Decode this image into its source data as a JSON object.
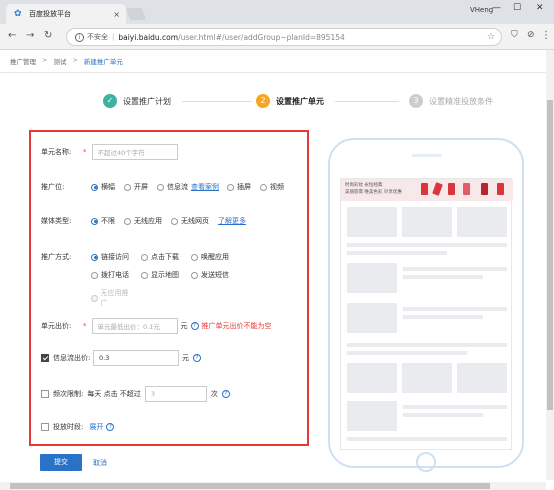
{
  "browser": {
    "tab_title": "百度投放平台",
    "tab_close": "×",
    "user_name": "VHeng",
    "win_minimize": "—",
    "win_maximize": "☐",
    "win_close": "✕",
    "security_label": "不安全",
    "url_host": "baiyi.baidu.com",
    "url_path": "/user.html#/user/addGroup~planId=895154"
  },
  "breadcrumb": {
    "items": [
      "推广管理",
      "测试",
      "新建推广单元"
    ],
    "separator": ">"
  },
  "steps": [
    {
      "num": "✓",
      "label": "设置推广计划",
      "state": "done"
    },
    {
      "num": "2",
      "label": "设置推广单元",
      "state": "active"
    },
    {
      "num": "3",
      "label": "设置精准投放条件",
      "state": "pending"
    }
  ],
  "form": {
    "unit_name": {
      "label": "单元名称:",
      "required": "*",
      "placeholder": "不超过40个字符"
    },
    "position": {
      "label": "推广位:",
      "options": [
        "横幅",
        "开屏",
        "信息流",
        "插屏",
        "视频"
      ],
      "selected": "横幅",
      "example_link": "查看案例"
    },
    "media_type": {
      "label": "媒体类型:",
      "options": [
        "不限",
        "无线应用",
        "无线网页"
      ],
      "selected": "不限",
      "more_link": "了解更多"
    },
    "promo_method": {
      "label": "推广方式:",
      "options": [
        "链接访问",
        "点击下载",
        "唤醒应用",
        "拨打电话",
        "显示地图",
        "发送短信",
        "无应用推广"
      ],
      "selected": "链接访问",
      "disabled": "无应用推广"
    },
    "unit_bid": {
      "label": "单元出价:",
      "required": "*",
      "placeholder": "单元最低出价：0.1元",
      "unit": "元",
      "help": "?",
      "error": "推广单元出价不能为空"
    },
    "feed_bid": {
      "label": "信息流出价:",
      "checked": true,
      "value": "0.3",
      "unit": "元",
      "help": "?"
    },
    "frequency": {
      "label": "频次限制:",
      "checked": false,
      "prefix": "每天 点击 不超过",
      "value": "3",
      "unit": "次",
      "help": "?"
    },
    "schedule": {
      "label": "投放时段:",
      "checked": false,
      "expand": "展开",
      "help": "?"
    }
  },
  "actions": {
    "submit": "提交",
    "cancel": "取消"
  },
  "preview": {
    "banner_text_1": "时尚彩妆 永恒经典",
    "banner_text_2": "美丽唇膏 唯美色彩 尽享优惠"
  },
  "colors": {
    "accent": "#2a72c8",
    "done": "#3bb3a0",
    "active": "#f5a623",
    "pending": "#cccccc",
    "error": "#e53935"
  }
}
